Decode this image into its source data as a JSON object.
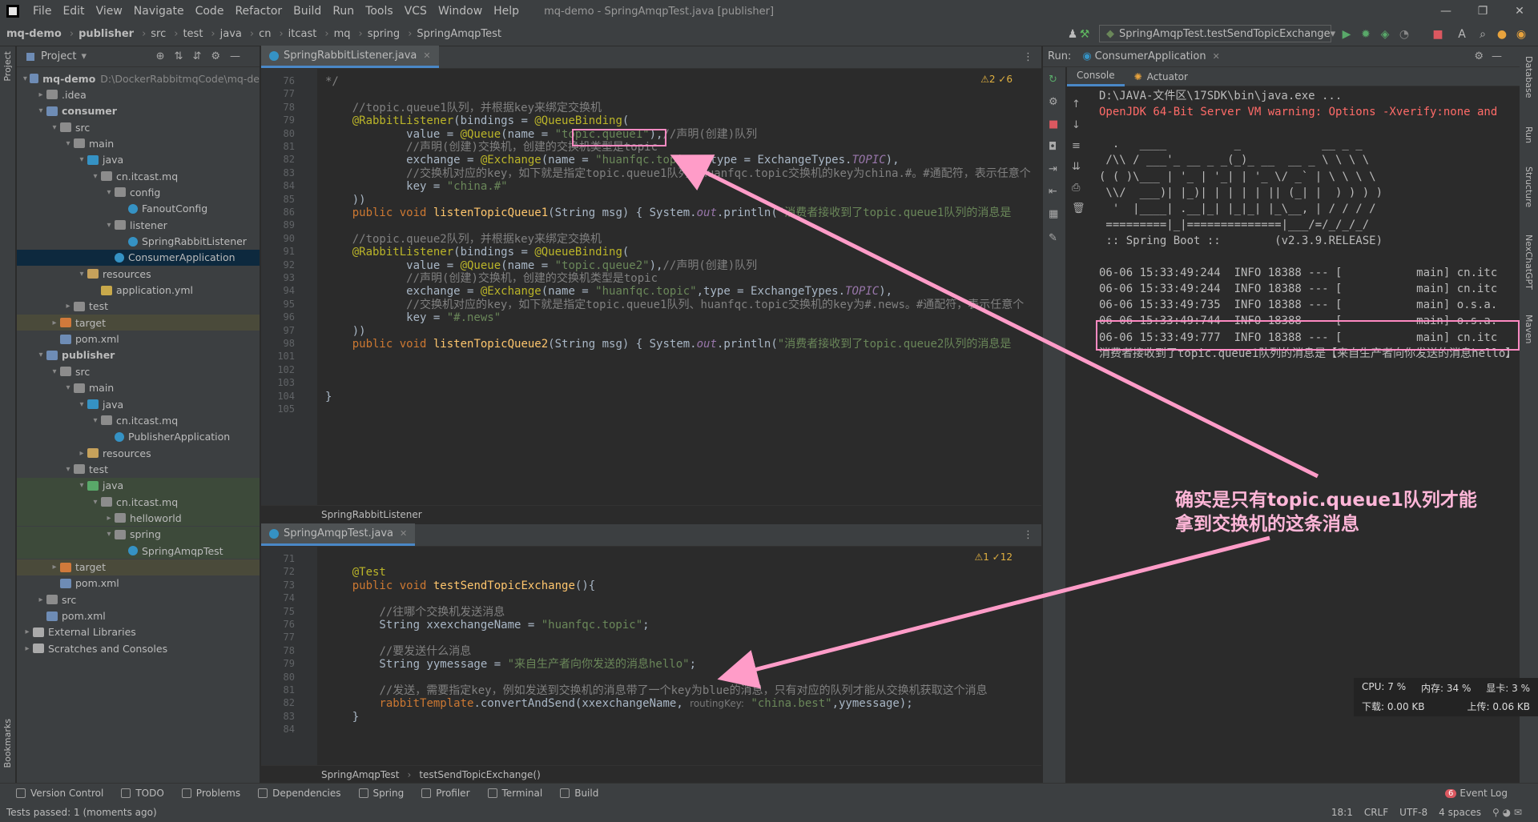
{
  "menubar": {
    "items": [
      "File",
      "Edit",
      "View",
      "Navigate",
      "Code",
      "Refactor",
      "Build",
      "Run",
      "Tools",
      "VCS",
      "Window",
      "Help"
    ],
    "window_title": "mq-demo - SpringAmqpTest.java [publisher]"
  },
  "navbar": {
    "crumbs": [
      "mq-demo",
      "publisher",
      "src",
      "test",
      "java",
      "cn",
      "itcast",
      "mq",
      "spring",
      "SpringAmqpTest"
    ],
    "run_config": "SpringAmqpTest.testSendTopicExchange"
  },
  "side_tabs": {
    "left": [
      "Project",
      "Bookmarks"
    ],
    "right": [
      "Database",
      "Run",
      "Structure",
      "NexChatGPT",
      "Maven"
    ]
  },
  "project": {
    "title": "Project",
    "tree": [
      {
        "label": "mq-demo",
        "note": "D:\\DockerRabbitmqCode\\mq-de",
        "depth": 0,
        "icon": "module",
        "arrow": "v"
      },
      {
        "label": ".idea",
        "depth": 1,
        "icon": "folder",
        "arrow": ">"
      },
      {
        "label": "consumer",
        "depth": 1,
        "icon": "module",
        "arrow": "v"
      },
      {
        "label": "src",
        "depth": 2,
        "icon": "folder",
        "arrow": "v"
      },
      {
        "label": "main",
        "depth": 3,
        "icon": "folder",
        "arrow": "v"
      },
      {
        "label": "java",
        "depth": 4,
        "icon": "src",
        "arrow": "v"
      },
      {
        "label": "cn.itcast.mq",
        "depth": 5,
        "icon": "folder",
        "arrow": "v"
      },
      {
        "label": "config",
        "depth": 6,
        "icon": "folder",
        "arrow": "v"
      },
      {
        "label": "FanoutConfig",
        "depth": 7,
        "icon": "class",
        "arrow": ""
      },
      {
        "label": "listener",
        "depth": 6,
        "icon": "folder",
        "arrow": "v"
      },
      {
        "label": "SpringRabbitListener",
        "depth": 7,
        "icon": "class",
        "arrow": ""
      },
      {
        "label": "ConsumerApplication",
        "depth": 6,
        "icon": "class",
        "arrow": "",
        "state": "sel"
      },
      {
        "label": "resources",
        "depth": 4,
        "icon": "res",
        "arrow": "v"
      },
      {
        "label": "application.yml",
        "depth": 5,
        "icon": "yml",
        "arrow": ""
      },
      {
        "label": "test",
        "depth": 3,
        "icon": "folder",
        "arrow": ">"
      },
      {
        "label": "target",
        "depth": 2,
        "icon": "target",
        "arrow": ">",
        "state": "hl"
      },
      {
        "label": "pom.xml",
        "depth": 2,
        "icon": "pom",
        "arrow": ""
      },
      {
        "label": "publisher",
        "depth": 1,
        "icon": "module",
        "arrow": "v"
      },
      {
        "label": "src",
        "depth": 2,
        "icon": "folder",
        "arrow": "v"
      },
      {
        "label": "main",
        "depth": 3,
        "icon": "folder",
        "arrow": "v"
      },
      {
        "label": "java",
        "depth": 4,
        "icon": "src",
        "arrow": "v"
      },
      {
        "label": "cn.itcast.mq",
        "depth": 5,
        "icon": "folder",
        "arrow": "v"
      },
      {
        "label": "PublisherApplication",
        "depth": 6,
        "icon": "class",
        "arrow": ""
      },
      {
        "label": "resources",
        "depth": 4,
        "icon": "res",
        "arrow": ">"
      },
      {
        "label": "test",
        "depth": 3,
        "icon": "folder",
        "arrow": "v"
      },
      {
        "label": "java",
        "depth": 4,
        "icon": "testsrc",
        "arrow": "v",
        "state": "hl2"
      },
      {
        "label": "cn.itcast.mq",
        "depth": 5,
        "icon": "folder",
        "arrow": "v",
        "state": "hl2"
      },
      {
        "label": "helloworld",
        "depth": 6,
        "icon": "folder",
        "arrow": ">",
        "state": "hl2"
      },
      {
        "label": "spring",
        "depth": 6,
        "icon": "folder",
        "arrow": "v",
        "state": "hl2"
      },
      {
        "label": "SpringAmqpTest",
        "depth": 7,
        "icon": "class",
        "arrow": "",
        "state": "hl2"
      },
      {
        "label": "target",
        "depth": 2,
        "icon": "target",
        "arrow": ">",
        "state": "hl"
      },
      {
        "label": "pom.xml",
        "depth": 2,
        "icon": "pom",
        "arrow": ""
      },
      {
        "label": "src",
        "depth": 1,
        "icon": "folder",
        "arrow": ">"
      },
      {
        "label": "pom.xml",
        "depth": 1,
        "icon": "pom",
        "arrow": ""
      },
      {
        "label": "External Libraries",
        "depth": 0,
        "icon": "lib",
        "arrow": ">"
      },
      {
        "label": "Scratches and Consoles",
        "depth": 0,
        "icon": "scratch",
        "arrow": ">"
      }
    ]
  },
  "editor1": {
    "tab": "SpringRabbitListener.java",
    "inspections": "⚠2 ✓6",
    "breadcrumb": "SpringRabbitListener",
    "lines": [
      {
        "n": "76",
        "html": "<span class='cm'>*/</span>"
      },
      {
        "n": "77",
        "html": ""
      },
      {
        "n": "78",
        "html": "    <span class='cm'>//topic.queue1队列，并根据key来绑定交换机</span>"
      },
      {
        "n": "79",
        "html": "    <span class='an'>@RabbitListener</span>(bindings = <span class='an'>@QueueBinding</span>("
      },
      {
        "n": "80",
        "html": "            value = <span class='an'>@Queue</span>(name = <span class='st'>\"topic.queue1\"</span>),<span class='cm'>//声明(创建)队列</span>"
      },
      {
        "n": "81",
        "html": "            <span class='cm'>//声明(创建)交换机，创建的交换机类型是topic</span>"
      },
      {
        "n": "82",
        "html": "            exchange = <span class='an'>@Exchange</span>(name = <span class='st'>\"huanfqc.topic\"</span>, type = ExchangeTypes.<span class='it'>TOPIC</span>),"
      },
      {
        "n": "83",
        "html": "            <span class='cm'>//交换机对应的key，如下就是指定topic.queue1队列、huanfqc.topic交换机的key为china.#。#通配符，表示任意个</span>"
      },
      {
        "n": "84",
        "html": "            key = <span class='st'>\"china.#\"</span>"
      },
      {
        "n": "85",
        "html": "    ))"
      },
      {
        "n": "86",
        "html": "    <span class='kw'>public void</span> <span class='fn'>listenTopicQueue1</span>(String msg) { System.<span class='it'>out</span>.println(<span class='st'>\"消费者接收到了topic.queue1队列的消息是</span>"
      },
      {
        "n": "89",
        "html": ""
      },
      {
        "n": "90",
        "html": "    <span class='cm'>//topic.queue2队列，并根据key来绑定交换机</span>"
      },
      {
        "n": "91",
        "html": "    <span class='an'>@RabbitListener</span>(bindings = <span class='an'>@QueueBinding</span>("
      },
      {
        "n": "92",
        "html": "            value = <span class='an'>@Queue</span>(name = <span class='st'>\"topic.queue2\"</span>),<span class='cm'>//声明(创建)队列</span>"
      },
      {
        "n": "93",
        "html": "            <span class='cm'>//声明(创建)交换机，创建的交换机类型是topic</span>"
      },
      {
        "n": "94",
        "html": "            exchange = <span class='an'>@Exchange</span>(name = <span class='st'>\"huanfqc.topic\"</span>,type = ExchangeTypes.<span class='it'>TOPIC</span>),"
      },
      {
        "n": "95",
        "html": "            <span class='cm'>//交换机对应的key，如下就是指定topic.queue1队列、huanfqc.topic交换机的key为#.news。#通配符，表示任意个</span>"
      },
      {
        "n": "96",
        "html": "            key = <span class='st'>\"#.news\"</span>"
      },
      {
        "n": "97",
        "html": "    ))"
      },
      {
        "n": "98",
        "html": "    <span class='kw'>public void</span> <span class='fn'>listenTopicQueue2</span>(String msg) { System.<span class='it'>out</span>.println(<span class='st'>\"消费者接收到了topic.queue2队列的消息是</span>"
      },
      {
        "n": "101",
        "html": ""
      },
      {
        "n": "102",
        "html": ""
      },
      {
        "n": "103",
        "html": ""
      },
      {
        "n": "104",
        "html": "}"
      },
      {
        "n": "105",
        "html": ""
      }
    ]
  },
  "editor2": {
    "tab": "SpringAmqpTest.java",
    "inspections": "⚠1 ✓12",
    "breadcrumb": [
      "SpringAmqpTest",
      "testSendTopicExchange()"
    ],
    "lines": [
      {
        "n": "71",
        "html": ""
      },
      {
        "n": "72",
        "html": "    <span class='an'>@Test</span>"
      },
      {
        "n": "73",
        "html": "    <span class='kw'>public void</span> <span class='fn'>testSendTopicExchange</span>(){"
      },
      {
        "n": "74",
        "html": ""
      },
      {
        "n": "75",
        "html": "        <span class='cm'>//往哪个交换机发送消息</span>"
      },
      {
        "n": "76",
        "html": "        String xxexchangeName = <span class='st'>\"huanfqc.topic\"</span>;"
      },
      {
        "n": "77",
        "html": ""
      },
      {
        "n": "78",
        "html": "        <span class='cm'>//要发送什么消息</span>"
      },
      {
        "n": "79",
        "html": "        String yymessage = <span class='st'>\"来自生产者向你发送的消息hello\"</span>;"
      },
      {
        "n": "80",
        "html": ""
      },
      {
        "n": "81",
        "html": "        <span class='cm'>//发送，需要指定key，例如发送到交换机的消息带了一个key为blue的消息，只有对应的队列才能从交换机获取这个消息</span>"
      },
      {
        "n": "82",
        "html": "        <span class='kw'>rabbitTemplate</span>.convertAndSend(xxexchangeName, <span class='hint'>routingKey:</span> <span class='st'>\"china.best\"</span>,yymessage);"
      },
      {
        "n": "83",
        "html": "    }"
      },
      {
        "n": "84",
        "html": ""
      }
    ]
  },
  "run": {
    "label": "Run:",
    "config": "ConsumerApplication",
    "tabs": [
      "Console",
      "Actuator"
    ],
    "console": [
      {
        "t": "D:\\JAVA-文件区\\17SDK\\bin\\java.exe ...",
        "c": "#bbbbbb"
      },
      {
        "t": "OpenJDK 64-Bit Server VM warning: Options -Xverify:none and",
        "c": "#ff6b68"
      },
      {
        "t": "",
        "c": "#bbb"
      },
      {
        "t": "  .   ____          _            __ _ _",
        "c": "#bbb"
      },
      {
        "t": " /\\\\ / ___'_ __ _ _(_)_ __  __ _ \\ \\ \\ \\",
        "c": "#bbb"
      },
      {
        "t": "( ( )\\___ | '_ | '_| | '_ \\/ _` | \\ \\ \\ \\",
        "c": "#bbb"
      },
      {
        "t": " \\\\/  ___)| |_)| | | | | || (_| |  ) ) ) )",
        "c": "#bbb"
      },
      {
        "t": "  '  |____| .__|_| |_|_| |_\\__, | / / / /",
        "c": "#bbb"
      },
      {
        "t": " =========|_|==============|___/=/_/_/_/",
        "c": "#bbb"
      },
      {
        "t": " :: Spring Boot ::        (v2.3.9.RELEASE)",
        "c": "#bbb"
      },
      {
        "t": "",
        "c": "#bbb"
      },
      {
        "t": "06-06 15:33:49:244  INFO 18388 --- [           main] cn.itc",
        "c": "#bbb"
      },
      {
        "t": "06-06 15:33:49:244  INFO 18388 --- [           main] cn.itc",
        "c": "#bbb"
      },
      {
        "t": "06-06 15:33:49:735  INFO 18388 --- [           main] o.s.a.",
        "c": "#bbb"
      },
      {
        "t": "06-06 15:33:49:744  INFO 18388 --- [           main] o.s.a.",
        "c": "#bbb"
      },
      {
        "t": "06-06 15:33:49:777  INFO 18388 --- [           main] cn.itc",
        "c": "#bbb"
      },
      {
        "t": "消费者接收到了topic.queue1队列的消息是【来自生产者向你发送的消息hello】",
        "c": "#bbbbbb"
      }
    ]
  },
  "annotation": "确实是只有topic.queue1队列才能\n拿到交换机的这条消息",
  "perf": {
    "cpu": "CPU: 7 %",
    "mem": "内存: 34 %",
    "gpu": "显卡: 3 %",
    "down": "下载: 0.00 KB",
    "up": "上传: 0.06 KB"
  },
  "toolwindows": [
    "Version Control",
    "TODO",
    "Problems",
    "Dependencies",
    "Spring",
    "Profiler",
    "Terminal",
    "Build"
  ],
  "event_log": "Event Log",
  "event_count": "6",
  "status": {
    "left": "Tests passed: 1 (moments ago)",
    "pos": "18:1",
    "sep": "CRLF",
    "enc": "UTF-8",
    "indent": "4 spaces"
  },
  "colors": {
    "accent": "#4a88c7",
    "annotation": "#ff8ac2"
  }
}
